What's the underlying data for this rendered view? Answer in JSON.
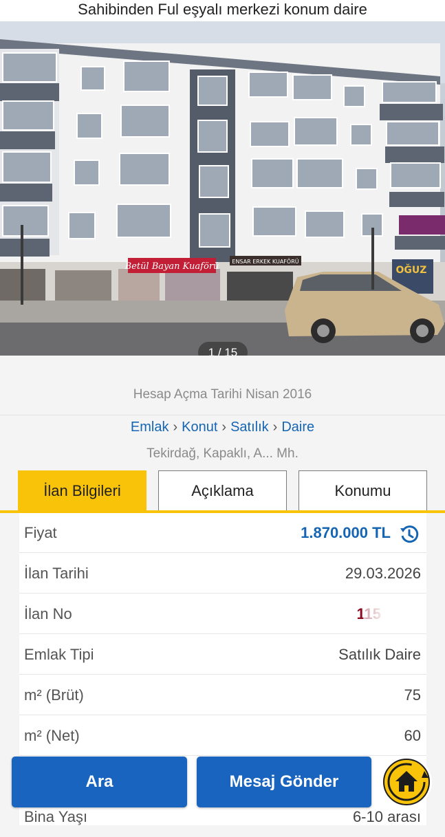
{
  "header": {
    "title": "Sahibinden Ful eşyalı merkezi konum daire"
  },
  "gallery": {
    "counter": "1 / 15",
    "signs": [
      "Betül Bayan Kuaförü",
      "ENSAR ERKEK KUAFÖRÜ",
      "OĞUZ"
    ]
  },
  "account": {
    "opened": "Hesap Açma Tarihi  Nisan 2016"
  },
  "breadcrumb": [
    "Emlak",
    "Konut",
    "Satılık",
    "Daire"
  ],
  "breadcrumb_separator": "›",
  "location": "Tekirdağ, Kapaklı, A... Mh.",
  "tabs": [
    {
      "label": "İlan Bilgileri",
      "active": true
    },
    {
      "label": "Açıklama",
      "active": false
    },
    {
      "label": "Konumu",
      "active": false
    }
  ],
  "details": [
    {
      "label": "Fiyat",
      "value": "1.870.000 TL"
    },
    {
      "label": "İlan Tarihi",
      "value": "29.03.2026"
    },
    {
      "label": "İlan No",
      "value": "115"
    },
    {
      "label": "Emlak Tipi",
      "value": "Satılık Daire"
    },
    {
      "label": "m² (Brüt)",
      "value": "75"
    },
    {
      "label": "m² (Net)",
      "value": "60"
    },
    {
      "label": "Bina Yaşı",
      "value": "6-10 arası"
    }
  ],
  "actions": {
    "call": "Ara",
    "message": "Mesaj Gönder"
  },
  "colors": {
    "accent": "#f9c30a",
    "primary": "#1864bf",
    "link": "#1565b3"
  }
}
